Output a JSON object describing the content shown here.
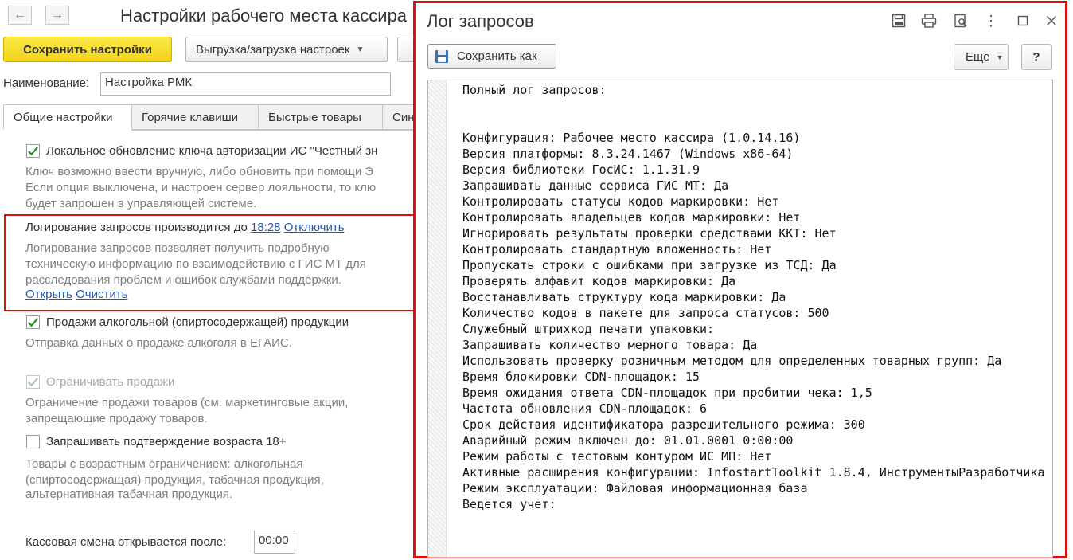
{
  "settings": {
    "title": "Настройки рабочего места кассира",
    "save_button": "Сохранить настройки",
    "export_button": "Выгрузка/загрузка настроек",
    "name_label": "Наименование:",
    "name_value": "Настройка РМК",
    "tabs": [
      "Общие настройки",
      "Горячие клавиши",
      "Быстрые товары",
      "Син"
    ],
    "opt_local_update": {
      "label": "Локальное обновление ключа авторизации ИС \"Честный зн",
      "checked": true,
      "hint": [
        "Ключ возможно ввести вручную, либо обновить при помощи Э",
        "Если опция выключена, и настроен сервер лояльности, то клю",
        "будет запрошен в управляющей системе."
      ]
    },
    "logging": {
      "text": "Логирование запросов производится до",
      "time_link": "18:28",
      "disable_link": "Отключить",
      "hint": [
        "Логирование запросов позволяет получить подробную",
        "техническую информацию по взаимодействию с ГИС МТ для",
        "расследования проблем и ошибок службами поддержки."
      ],
      "open_link": "Открыть",
      "clear_link": "Очистить"
    },
    "opt_alcohol": {
      "label": "Продажи алкогольной (спиртосодержащей) продукции",
      "checked": true,
      "hint": [
        "Отправка данных о продаже алкоголя в ЕГАИС."
      ]
    },
    "opt_restrict": {
      "label": "Ограничивать продажи",
      "checked": true,
      "disabled": true,
      "hint": [
        "Ограничение продажи товаров (см. маркетинговые акции,",
        "запрещающие продажу товаров."
      ]
    },
    "opt_age": {
      "label": "Запрашивать подтверждение возраста 18+",
      "checked": false,
      "hint": [
        "Товары с возрастным ограничением: алкогольная",
        "(спиртосодержащая) продукция, табачная продукция,",
        "альтернативная табачная продукция."
      ]
    },
    "shift_label": "Кассовая смена открывается после:",
    "shift_value": "00:00"
  },
  "log_window": {
    "title": "Лог запросов",
    "save_as_button": "Сохранить как",
    "more_button": "Еще",
    "help_button": "?",
    "lines": [
      "Полный лог запросов:",
      "",
      "",
      "Конфигурация: Рабочее место кассира (1.0.14.16)",
      "Версия платформы: 8.3.24.1467 (Windows x86-64)",
      "Версия библиотеки ГосИС: 1.1.31.9",
      "Запрашивать данные сервиса ГИС МТ: Да",
      "Контролировать статусы кодов маркировки: Нет",
      "Контролировать владельцев кодов маркировки: Нет",
      "Игнорировать результаты проверки средствами ККТ: Нет",
      "Контролировать стандартную вложенность: Нет",
      "Пропускать строки с ошибками при загрузке из ТСД: Да",
      "Проверять алфавит кодов маркировки: Да",
      "Восстанавливать структуру кода маркировки: Да",
      "Количество кодов в пакете для запроса статусов: 500",
      "Служебный штрихкод печати упаковки:",
      "Запрашивать количество мерного товара: Да",
      "Использовать проверку розничным методом для определенных товарных групп: Да",
      "Время блокировки CDN-площадок: 15",
      "Время ожидания ответа CDN-площадок при пробитии чека: 1,5",
      "Частота обновления CDN-площадок: 6",
      "Срок действия идентификатора разрешительного режима: 300",
      "Аварийный режим включен до: 01.01.0001 0:00:00",
      "Режим работы с тестовым контуром ИС МП: Нет",
      "Активные расширения конфигурации: InfostartToolkit 1.8.4, ИнструментыРазработчика",
      "Режим эксплуатации: Файловая информационная база",
      "Ведется учет:"
    ]
  },
  "colors": {
    "accent_yellow": "#f3d317",
    "highlight_red": "#e01010",
    "link_blue": "#2458a8",
    "check_green": "#2e8b2e"
  }
}
